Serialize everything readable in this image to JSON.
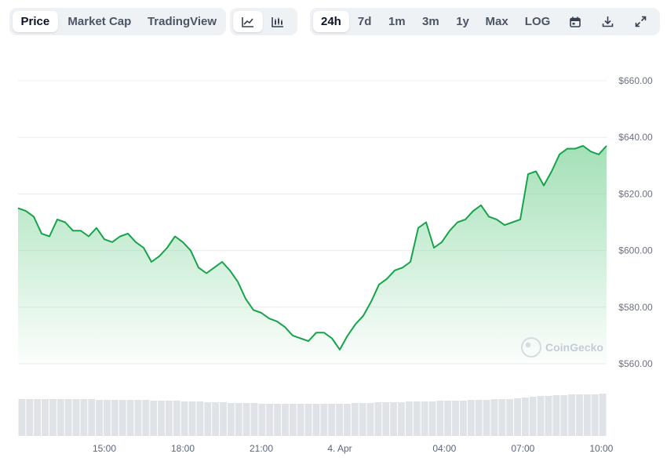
{
  "toolbar": {
    "view_tabs": [
      "Price",
      "Market Cap",
      "TradingView"
    ],
    "active_view": "Price",
    "chart_type_icons": [
      "line-chart-icon",
      "candlestick-chart-icon"
    ],
    "active_chart_type": "line-chart-icon",
    "range_tabs": [
      "24h",
      "7d",
      "1m",
      "3m",
      "1y",
      "Max",
      "LOG"
    ],
    "active_range": "24h",
    "tool_icons": [
      "calendar-icon",
      "download-icon",
      "fullscreen-icon"
    ]
  },
  "colors": {
    "line": "#16a34a",
    "fill_top": "#86d6a0",
    "grid": "#e8ecef",
    "volume": "#dfe3e8"
  },
  "watermark": "CoinGecko",
  "chart_data": {
    "type": "area",
    "title": "",
    "xlabel": "",
    "ylabel": "",
    "y_tick_labels": [
      "$660.00",
      "$640.00",
      "$620.00",
      "$600.00",
      "$580.00",
      "$560.00"
    ],
    "y_ticks": [
      660,
      640,
      620,
      600,
      580,
      560
    ],
    "ylim": [
      560,
      660
    ],
    "x_tick_labels": [
      "15:00",
      "18:00",
      "21:00",
      "4. Apr",
      "04:00",
      "07:00",
      "10:00"
    ],
    "x_ticks": [
      15,
      18,
      21,
      24,
      28,
      31,
      34
    ],
    "xlim": [
      11.7,
      34.2
    ],
    "grid": true,
    "series": [
      {
        "x": [
          11.7,
          12.0,
          12.3,
          12.6,
          12.9,
          13.2,
          13.5,
          13.8,
          14.1,
          14.4,
          14.7,
          15.0,
          15.3,
          15.6,
          15.9,
          16.2,
          16.5,
          16.8,
          17.1,
          17.4,
          17.7,
          18.0,
          18.3,
          18.6,
          18.9,
          19.2,
          19.5,
          19.8,
          20.1,
          20.4,
          20.7,
          21.0,
          21.3,
          21.6,
          21.9,
          22.2,
          22.5,
          22.8,
          23.1,
          23.4,
          23.7,
          24.0,
          24.3,
          24.6,
          24.9,
          25.2,
          25.5,
          25.8,
          26.1,
          26.4,
          26.7,
          27.0,
          27.3,
          27.6,
          27.9,
          28.2,
          28.5,
          28.8,
          29.1,
          29.4,
          29.7,
          30.0,
          30.3,
          30.6,
          30.9,
          31.2,
          31.5,
          31.8,
          32.1,
          32.4,
          32.7,
          33.0,
          33.3,
          33.6,
          33.9,
          34.2
        ],
        "y": [
          615,
          614,
          612,
          606,
          605,
          611,
          610,
          607,
          607,
          605,
          608,
          604,
          603,
          605,
          606,
          603,
          601,
          596,
          598,
          601,
          605,
          603,
          600,
          594,
          592,
          594,
          596,
          593,
          589,
          583,
          579,
          578,
          576,
          575,
          573,
          570,
          569,
          568,
          571,
          571,
          569,
          565,
          570,
          574,
          577,
          582,
          588,
          590,
          593,
          594,
          596,
          608,
          610,
          601,
          603,
          607,
          610,
          611,
          614,
          616,
          612,
          611,
          609,
          610,
          611,
          627,
          628,
          623,
          628,
          634,
          636,
          636,
          637,
          635,
          634,
          637
        ]
      }
    ],
    "volume": [
      47,
      47,
      47,
      47,
      47,
      47,
      47,
      47,
      47,
      47,
      46,
      46,
      46,
      46,
      46,
      46,
      46,
      45,
      45,
      45,
      45,
      44,
      44,
      44,
      43,
      43,
      43,
      42,
      42,
      42,
      42,
      41,
      41,
      41,
      41,
      41,
      41,
      41,
      41,
      41,
      41,
      41,
      41,
      42,
      42,
      42,
      43,
      43,
      43,
      43,
      44,
      44,
      44,
      44,
      45,
      45,
      45,
      45,
      46,
      46,
      46,
      47,
      47,
      47,
      48,
      49,
      50,
      51,
      51,
      52,
      52,
      53,
      53,
      53,
      53,
      54
    ]
  }
}
